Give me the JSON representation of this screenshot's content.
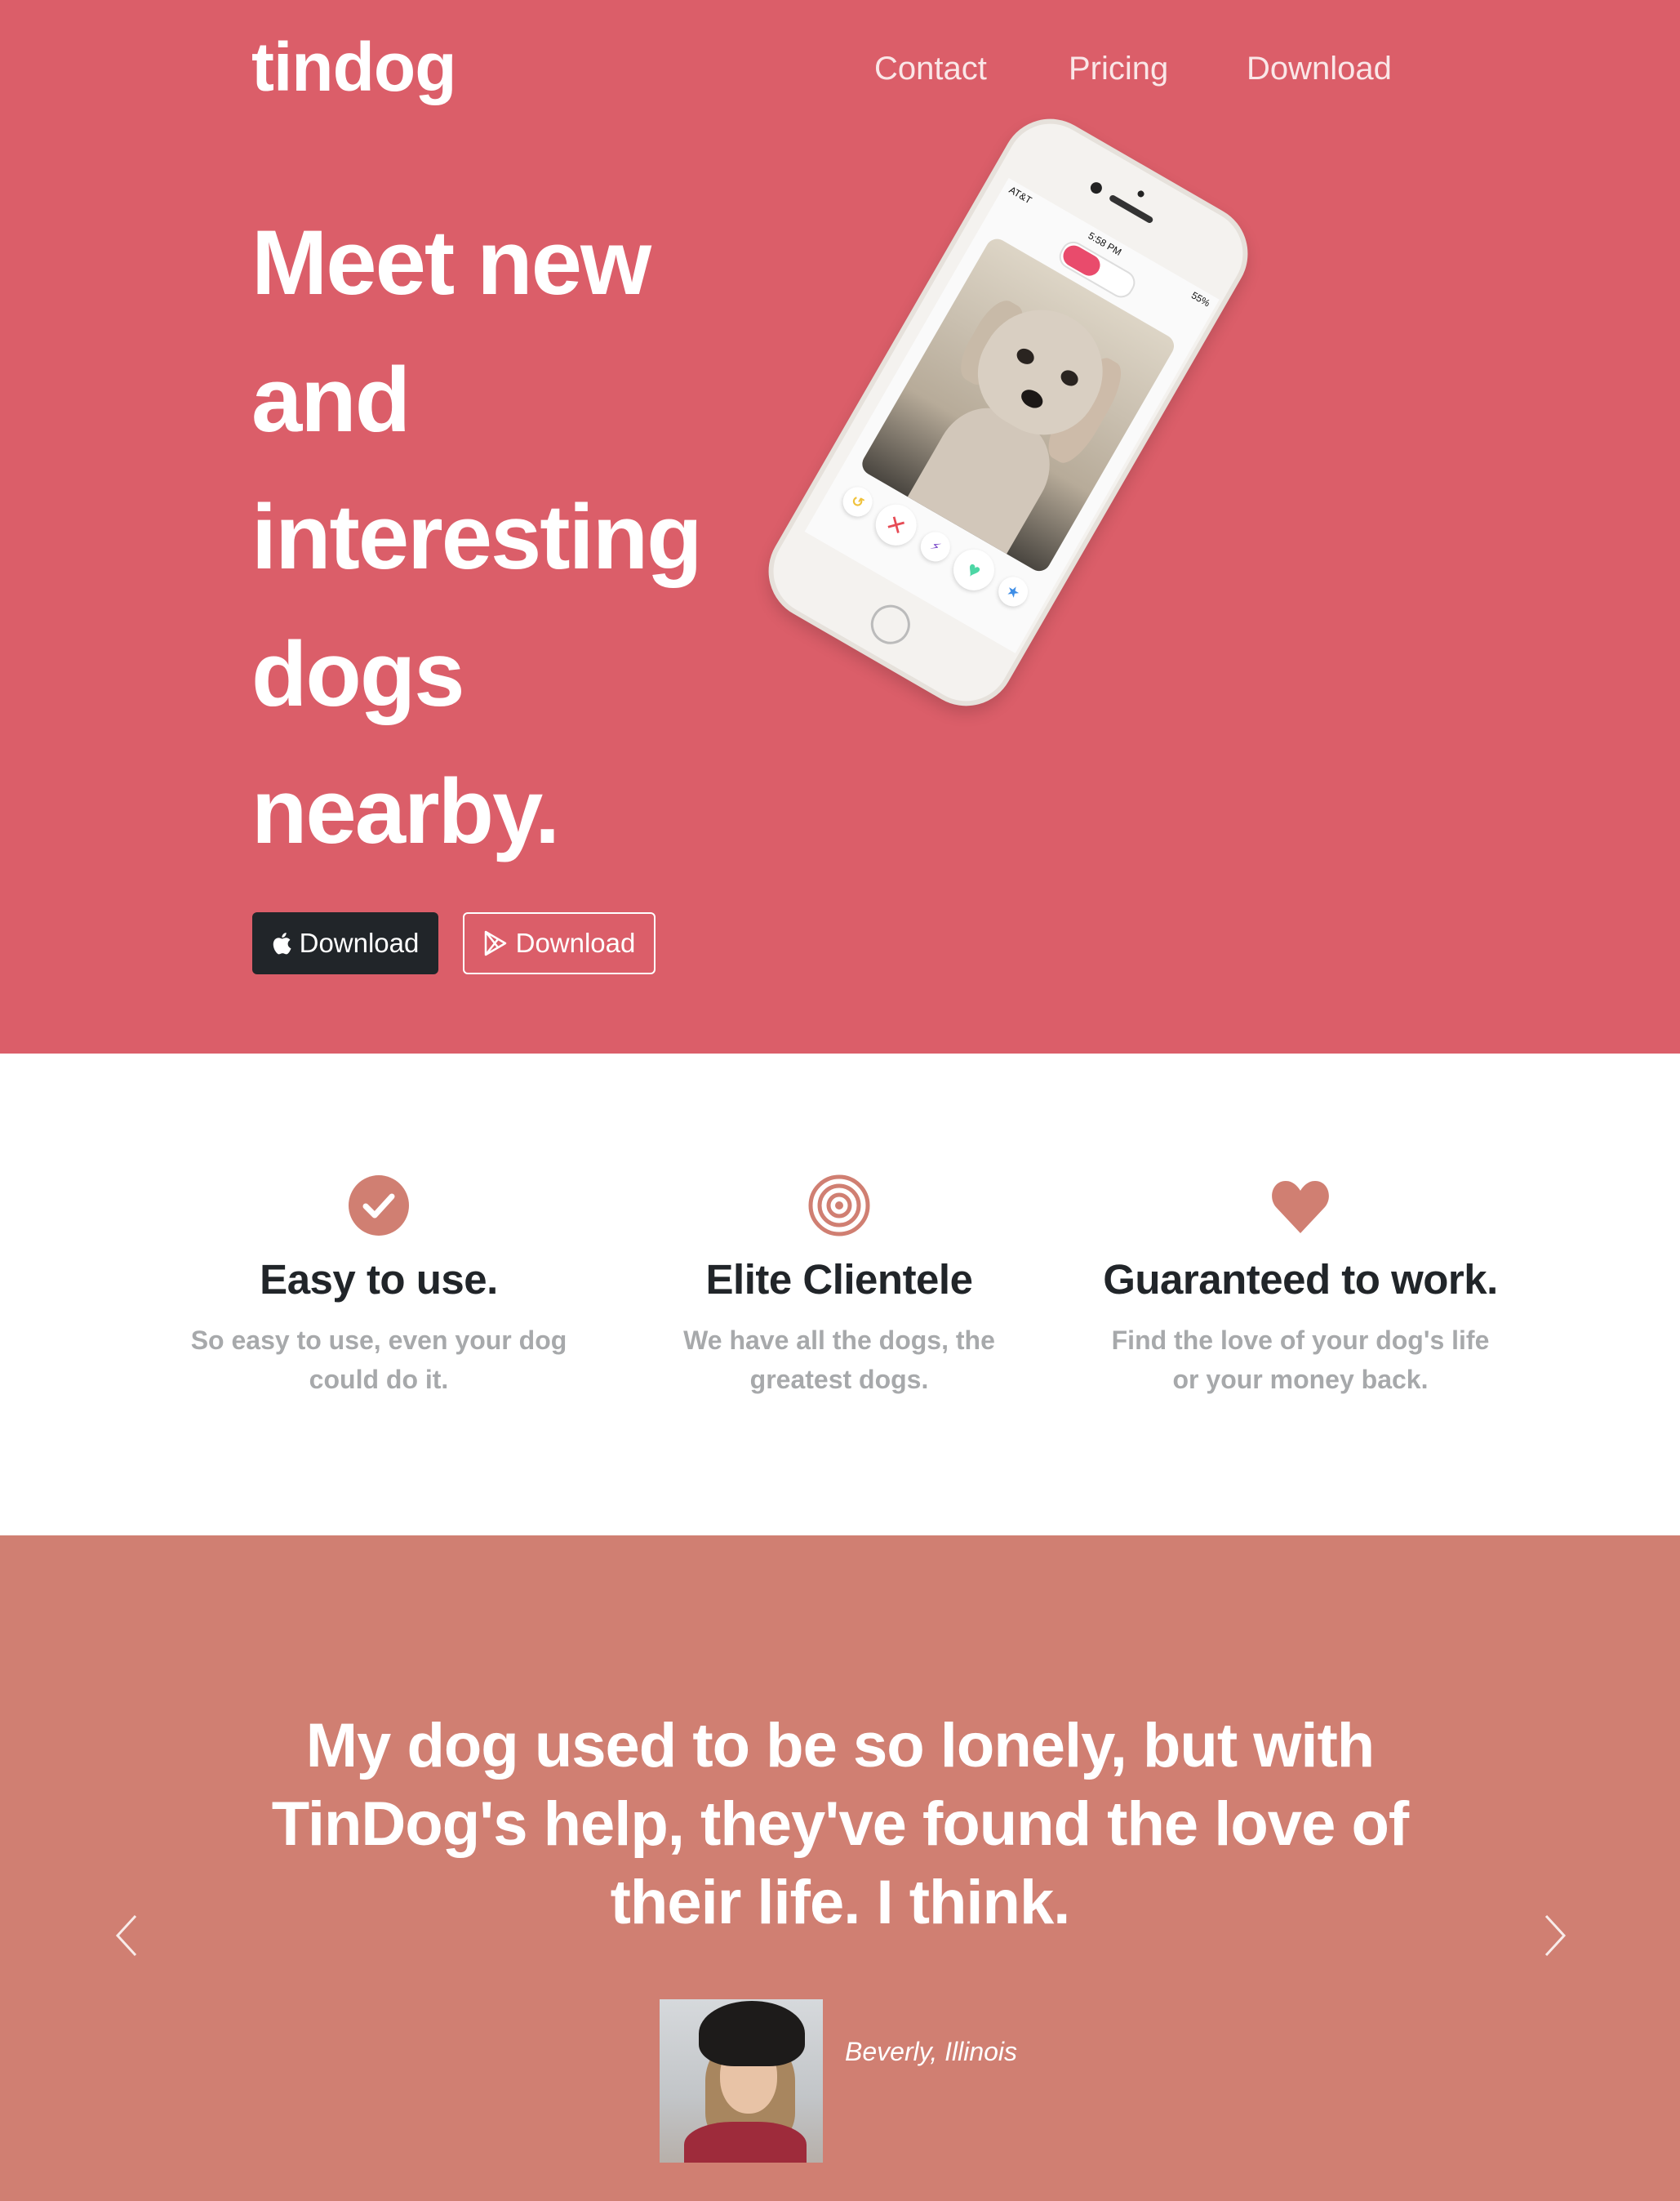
{
  "brand": "tindog",
  "nav": {
    "contact": "Contact",
    "pricing": "Pricing",
    "download": "Download"
  },
  "hero": {
    "headline_lines": [
      "Meet new",
      "and",
      "interesting",
      "dogs",
      "nearby."
    ],
    "apple_button": "Download",
    "play_button": "Download",
    "phone": {
      "carrier": "AT&T",
      "time": "5:58 PM",
      "battery": "55%"
    }
  },
  "features": [
    {
      "icon": "check-circle-icon",
      "title": "Easy to use.",
      "text": "So easy to use, even your dog could do it."
    },
    {
      "icon": "bullseye-icon",
      "title": "Elite Clientele",
      "text": "We have all the dogs, the greatest dogs."
    },
    {
      "icon": "heart-icon",
      "title": "Guaranteed to work.",
      "text": "Find the love of your dog's life or your money back."
    }
  ],
  "testimonial": {
    "quote": "My dog used to be so lonely, but with TinDog's help, they've found the love of their life. I think.",
    "author": "Beverly, Illinois"
  },
  "colors": {
    "hero_bg": "#db5e69",
    "testimonial_bg": "#d07f72",
    "icon_accent": "#d07f72",
    "dark_button": "#212529"
  }
}
